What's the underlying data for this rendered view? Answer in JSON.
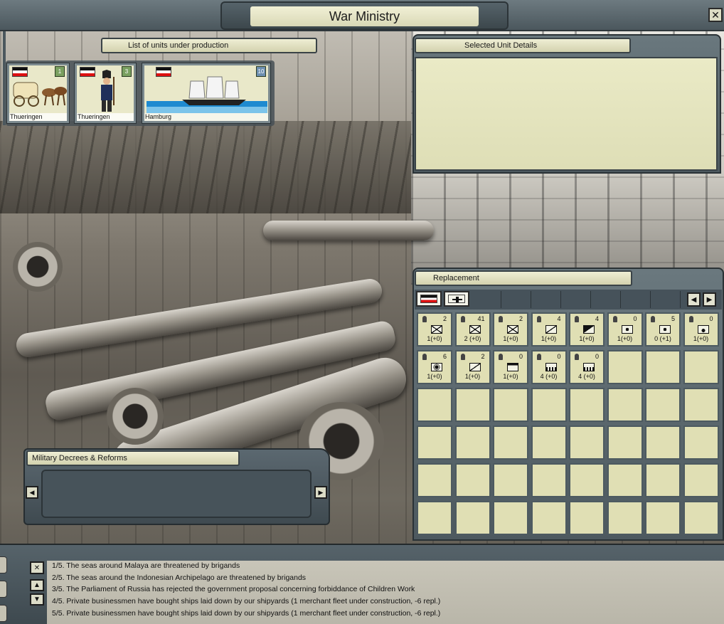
{
  "window": {
    "title": "War Ministry",
    "close_label": "✕"
  },
  "production": {
    "header": "List of units under production",
    "units": [
      {
        "name": "Thueringen",
        "badge": "1"
      },
      {
        "name": "Thueringen",
        "badge": "3"
      },
      {
        "name": "Hamburg",
        "badge": "10"
      }
    ]
  },
  "details": {
    "header": "Selected Unit Details"
  },
  "replacement": {
    "header": "Replacement",
    "prev_label": "◀",
    "next_label": "▶",
    "cells": [
      {
        "count": "2",
        "repl": "1(+0)"
      },
      {
        "count": "41",
        "repl": "2 (+0)"
      },
      {
        "count": "2",
        "repl": "1(+0)"
      },
      {
        "count": "4",
        "repl": "1(+0)"
      },
      {
        "count": "4",
        "repl": "1(+0)"
      },
      {
        "count": "0",
        "repl": "1(+0)"
      },
      {
        "count": "5",
        "repl": "0 (+1)"
      },
      {
        "count": "0",
        "repl": "1(+0)"
      },
      {
        "count": "6",
        "repl": "1(+0)"
      },
      {
        "count": "2",
        "repl": "1(+0)"
      },
      {
        "count": "0",
        "repl": "1(+0)"
      },
      {
        "count": "0",
        "repl": "4 (+0)"
      },
      {
        "count": "0",
        "repl": "4 (+0)"
      }
    ]
  },
  "decrees": {
    "header": "Military Decrees & Reforms",
    "prev_label": "◀",
    "next_label": "▶"
  },
  "log": {
    "close_label": "✕",
    "up_label": "▲",
    "down_label": "▼",
    "messages": [
      "1/5.  The seas around Malaya are threatened by brigands",
      "2/5.  The seas around the Indonesian Archipelago are threatened by brigands",
      "3/5.  The Parliament of Russia has rejected the government proposal concerning forbiddance of Children Work",
      "4/5.  Private businessmen have bought ships laid down by our shipyards (1 merchant fleet under construction, -6 repl.)",
      "5/5.  Private businessmen have bought ships laid down by our shipyards (1 merchant fleet under construction, -6 repl.)"
    ]
  }
}
